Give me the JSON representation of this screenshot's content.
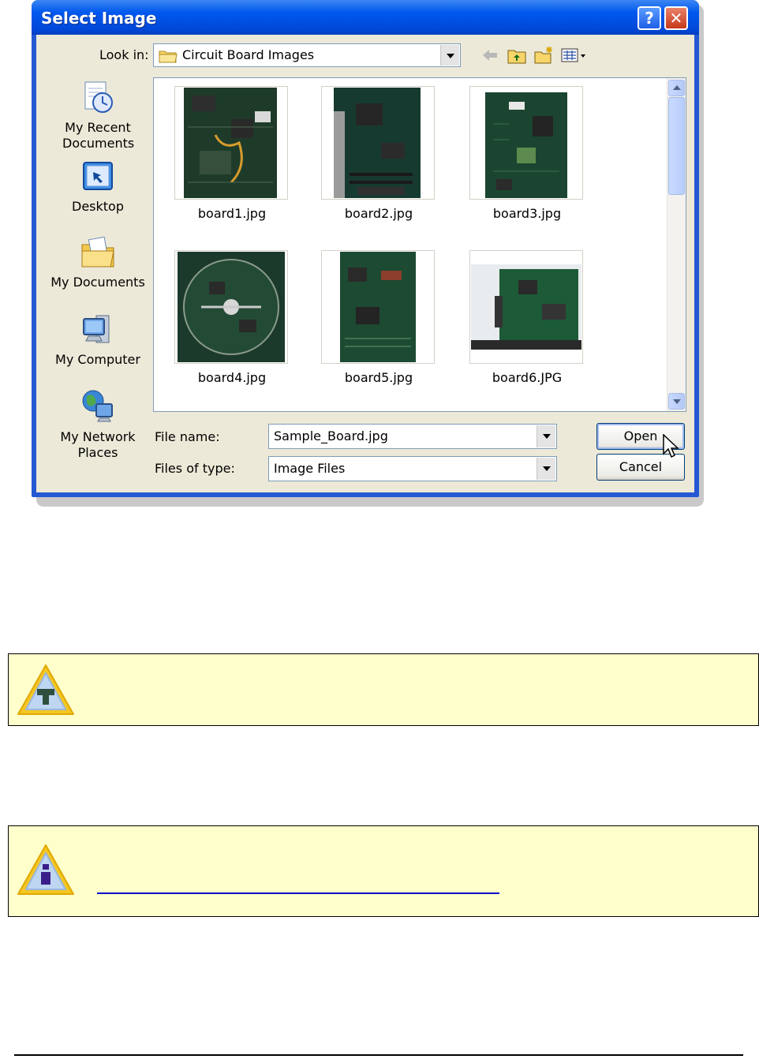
{
  "dialog": {
    "title": "Select Image",
    "help_button": "?",
    "close_button": "✕",
    "look_in_label": "Look in:",
    "look_in_value": "Circuit Board Images",
    "places": [
      {
        "label": "My Recent Documents",
        "icon": "recent-documents-icon"
      },
      {
        "label": "Desktop",
        "icon": "desktop-icon"
      },
      {
        "label": "My Documents",
        "icon": "my-documents-icon"
      },
      {
        "label": "My Computer",
        "icon": "my-computer-icon"
      },
      {
        "label": "My Network Places",
        "icon": "network-places-icon"
      }
    ],
    "files": [
      {
        "name": "board1.jpg"
      },
      {
        "name": "board2.jpg"
      },
      {
        "name": "board3.jpg"
      },
      {
        "name": "board4.jpg"
      },
      {
        "name": "board5.jpg"
      },
      {
        "name": "board6.JPG"
      }
    ],
    "file_name_label": "File name:",
    "file_name_value": "Sample_Board.jpg",
    "files_of_type_label": "Files of type:",
    "files_of_type_value": "Image Files",
    "open_button": "Open",
    "cancel_button": "Cancel"
  },
  "notes": [
    {
      "icon": "tip-warning-icon"
    },
    {
      "icon": "info-warning-icon"
    }
  ]
}
